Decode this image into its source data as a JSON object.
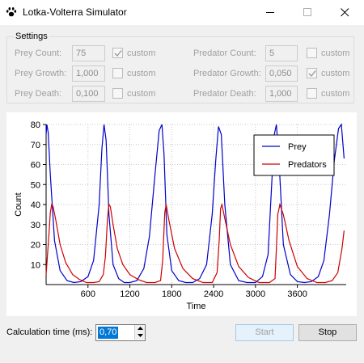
{
  "window": {
    "title": "Lotka-Volterra Simulator",
    "icon": "paw-icon"
  },
  "settings": {
    "title": "Settings",
    "custom_label": "custom",
    "prey_count": {
      "label": "Prey Count:",
      "value": "75",
      "custom": true
    },
    "prey_growth": {
      "label": "Prey Growth:",
      "value": "1,000",
      "custom": false
    },
    "prey_death": {
      "label": "Prey Death:",
      "value": "0,100",
      "custom": false
    },
    "predator_count": {
      "label": "Predator Count:",
      "value": "5",
      "custom": false
    },
    "predator_growth": {
      "label": "Predator Growth:",
      "value": "0,050",
      "custom": true
    },
    "predator_death": {
      "label": "Predator Death:",
      "value": "1,000",
      "custom": false
    }
  },
  "chart_data": {
    "type": "line",
    "xlabel": "Time",
    "ylabel": "Count",
    "xlim": [
      0,
      4300
    ],
    "ylim": [
      0,
      80
    ],
    "xticks": [
      600,
      1200,
      1800,
      2400,
      3000,
      3600
    ],
    "yticks": [
      10,
      20,
      30,
      40,
      50,
      60,
      70,
      80
    ],
    "grid": "dotted",
    "legend_position": "top-right",
    "series": [
      {
        "name": "Prey",
        "color": "#0000cc",
        "x": [
          0,
          10,
          30,
          60,
          120,
          200,
          300,
          400,
          500,
          600,
          680,
          760,
          800,
          830,
          860,
          900,
          960,
          1040,
          1120,
          1200,
          1300,
          1400,
          1480,
          1560,
          1620,
          1660,
          1690,
          1730,
          1800,
          1900,
          2000,
          2100,
          2200,
          2300,
          2380,
          2430,
          2470,
          2510,
          2560,
          2640,
          2760,
          2880,
          3000,
          3100,
          3180,
          3240,
          3270,
          3300,
          3340,
          3400,
          3500,
          3600,
          3700,
          3800,
          3900,
          3980,
          4060,
          4130,
          4190,
          4230,
          4270
        ],
        "y": [
          75,
          80,
          76,
          55,
          22,
          7,
          2,
          1,
          1.5,
          4,
          12,
          40,
          68,
          80,
          72,
          35,
          10,
          3,
          1,
          1,
          2,
          8,
          24,
          55,
          77,
          80,
          65,
          25,
          7,
          2,
          1,
          1,
          3,
          10,
          35,
          62,
          79,
          75,
          40,
          10,
          2,
          1,
          1,
          4,
          15,
          55,
          75,
          80,
          60,
          20,
          5,
          1.5,
          1,
          1.5,
          4,
          12,
          35,
          62,
          78,
          80,
          63
        ]
      },
      {
        "name": "Predators",
        "color": "#cc0000",
        "x": [
          0,
          40,
          60,
          80,
          100,
          140,
          200,
          280,
          380,
          480,
          580,
          680,
          760,
          820,
          850,
          880,
          900,
          920,
          960,
          1020,
          1100,
          1200,
          1320,
          1440,
          1560,
          1640,
          1670,
          1700,
          1720,
          1760,
          1840,
          1960,
          2100,
          2250,
          2380,
          2450,
          2480,
          2500,
          2520,
          2560,
          2640,
          2760,
          2900,
          3050,
          3200,
          3280,
          3300,
          3320,
          3350,
          3400,
          3480,
          3600,
          3740,
          3880,
          4000,
          4100,
          4180,
          4240,
          4270
        ],
        "y": [
          5,
          25,
          36,
          40,
          39,
          32,
          20,
          11,
          5,
          2.5,
          1,
          1,
          1.5,
          5,
          14,
          33,
          40,
          39,
          30,
          18,
          10,
          5,
          2.5,
          1,
          1,
          2,
          12,
          36,
          40,
          32,
          18,
          8,
          3,
          1,
          1,
          6,
          22,
          38,
          40,
          33,
          20,
          9,
          3.5,
          1,
          1,
          3,
          18,
          35,
          40,
          35,
          22,
          9,
          3,
          1,
          1,
          2,
          6,
          18,
          27
        ]
      }
    ]
  },
  "calc": {
    "label": "Calculation time (ms):",
    "value": "0,70"
  },
  "buttons": {
    "start": "Start",
    "stop": "Stop"
  }
}
